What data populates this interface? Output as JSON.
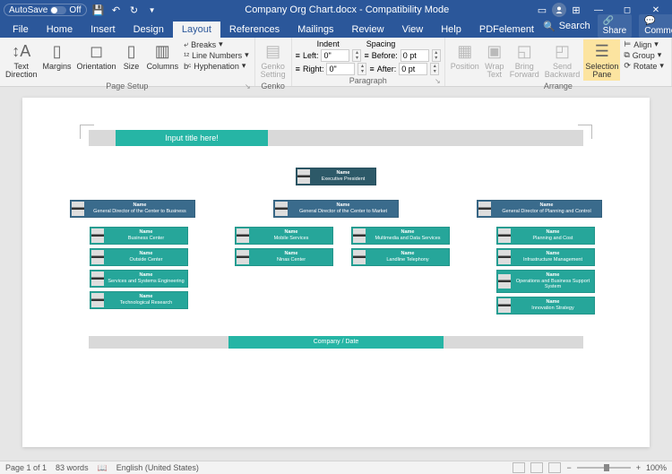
{
  "titlebar": {
    "autosave_label": "AutoSave",
    "autosave_state": "Off",
    "doc_title": "Company Org Chart.docx - Compatibility Mode"
  },
  "tabs": {
    "file": "File",
    "home": "Home",
    "insert": "Insert",
    "design": "Design",
    "layout": "Layout",
    "references": "References",
    "mailings": "Mailings",
    "review": "Review",
    "view": "View",
    "help": "Help",
    "pdfelement": "PDFelement",
    "search": "Search",
    "share": "Share",
    "comments": "Comments"
  },
  "ribbon": {
    "text_direction": "Text\nDirection",
    "margins": "Margins",
    "orientation": "Orientation",
    "size": "Size",
    "columns": "Columns",
    "breaks": "Breaks",
    "line_numbers": "Line Numbers",
    "hyphenation": "Hyphenation",
    "page_setup": "Page Setup",
    "genko_setting": "Genko\nSetting",
    "genko": "Genko",
    "indent_hdr": "Indent",
    "spacing_hdr": "Spacing",
    "left_lbl": "Left:",
    "right_lbl": "Right:",
    "before_lbl": "Before:",
    "after_lbl": "After:",
    "left_val": "0\"",
    "right_val": "0\"",
    "before_val": "0 pt",
    "after_val": "0 pt",
    "paragraph": "Paragraph",
    "position": "Position",
    "wrap_text": "Wrap\nText",
    "bring_forward": "Bring\nForward",
    "send_backward": "Send\nBackward",
    "selection_pane": "Selection\nPane",
    "align": "Align",
    "group": "Group",
    "rotate": "Rotate",
    "arrange": "Arrange"
  },
  "doc": {
    "title_placeholder": "Input title here!",
    "footer": "Company / Date",
    "name_lbl": "Name",
    "president": "Executive President",
    "dir1": "General Director of the Center to Business",
    "dir2": "General Director of the Center to Market",
    "dir3": "General Director of Planning and Control",
    "col1": [
      "Business Center",
      "Outside Center",
      "Services and Systems Engineering",
      "Technological Research"
    ],
    "col2": [
      "Mobile Services",
      "Ninas Center"
    ],
    "col2b": [
      "Multimedia and Data Services",
      "Landline Telephony"
    ],
    "col3": [
      "Planning and Cost",
      "Infrastructure Management",
      "Operations and Business Support System",
      "Innovation Strategy"
    ]
  },
  "status": {
    "page": "Page 1 of 1",
    "words": "83 words",
    "lang": "English (United States)",
    "zoom": "100%"
  }
}
